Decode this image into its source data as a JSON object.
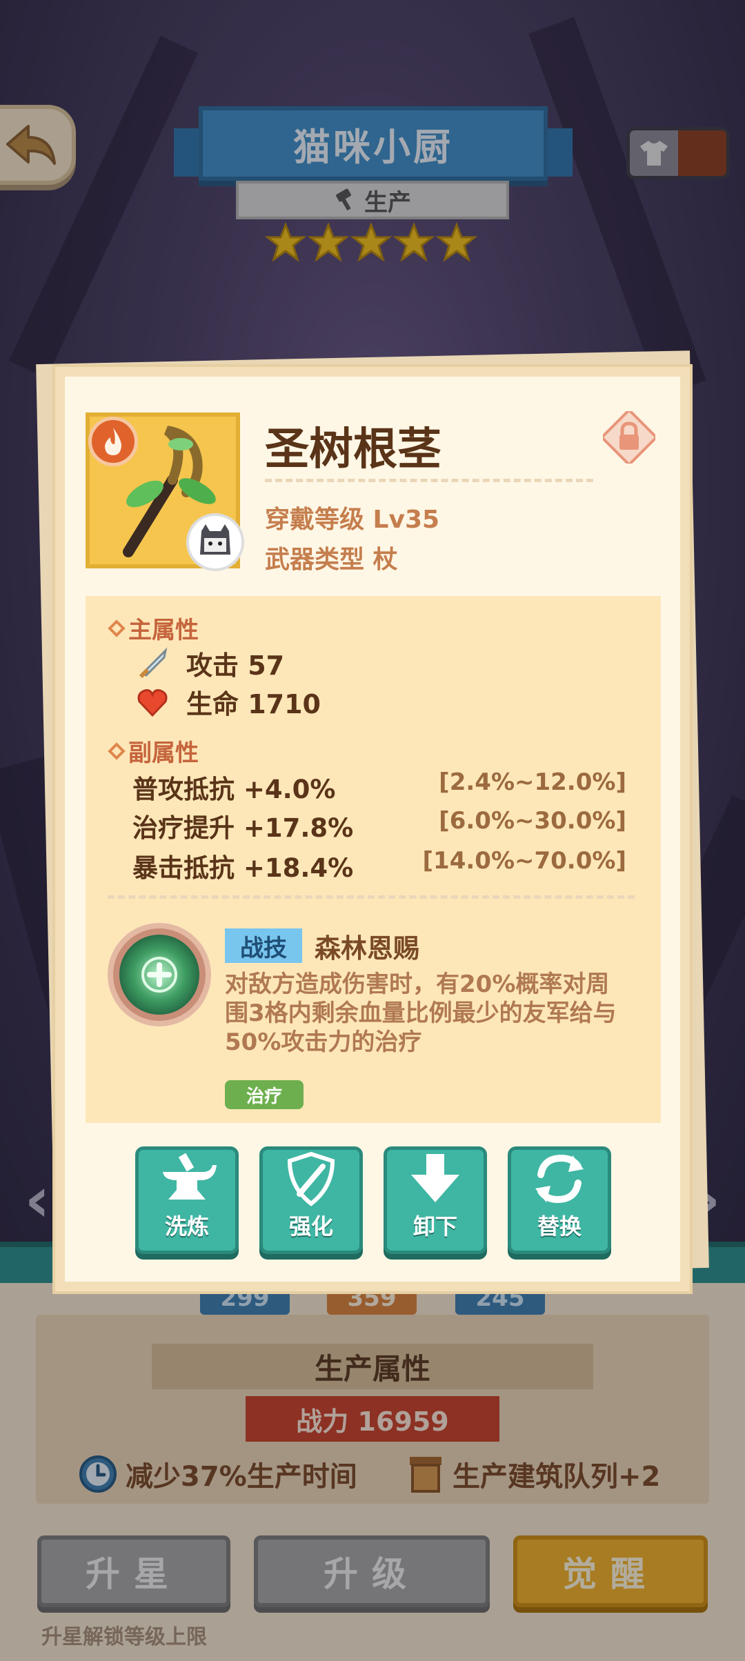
{
  "header": {
    "title": "猫咪小厨",
    "subtitle": "生产",
    "star_count": 5
  },
  "item": {
    "name": "圣树根茎",
    "wear_level": "穿戴等级 Lv35",
    "weapon_type": "武器类型 杖"
  },
  "main_attributes": {
    "heading": "主属性",
    "attack": "攻击 57",
    "hp": "生命 1710"
  },
  "sub_attributes": {
    "heading": "副属性",
    "rows": [
      {
        "name": "普攻抵抗 +4.0%",
        "range": "[2.4%~12.0%]"
      },
      {
        "name": "治疗提升 +17.8%",
        "range": "[6.0%~30.0%]"
      },
      {
        "name": "暴击抵抗 +18.4%",
        "range": "[14.0%~70.0%]"
      }
    ]
  },
  "skill": {
    "tag": "战技",
    "name": "森林恩赐",
    "description": "对敌方造成伤害时，有20%概率对周围3格内剩余血量比例最少的友军给与50%攻击力的治疗",
    "type_tag": "治疗"
  },
  "actions": {
    "refine": "洗炼",
    "enhance": "强化",
    "unequip": "卸下",
    "replace": "替换"
  },
  "level_chips": [
    "299",
    "359",
    "245"
  ],
  "production": {
    "title": "生产属性",
    "power": "战力 16959",
    "bonus_time": "减少37%生产时间",
    "bonus_queue": "生产建筑队列+2"
  },
  "bottom_buttons": {
    "star_up": "升星",
    "level_up": "升级",
    "awaken": "觉醒"
  },
  "hint": "升星解锁等级上限",
  "colors": {
    "title_blue": "#3f8fc7",
    "teal_button": "#3fb6a3",
    "power_red": "#c7432a",
    "awaken_gold": "#f0b228"
  }
}
